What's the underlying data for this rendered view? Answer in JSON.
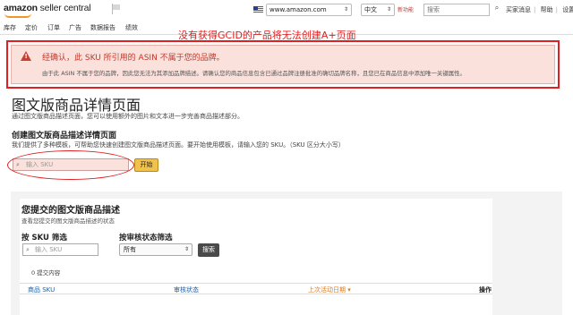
{
  "header": {
    "logo_brand": "amazon",
    "logo_product": "seller central",
    "marketplace": "www.amazon.com",
    "language": "中文",
    "new_badge": "新功能",
    "search_placeholder": "搜索",
    "links": [
      "买家消息",
      "帮助",
      "设置"
    ]
  },
  "nav": [
    "库存",
    "定价",
    "订单",
    "广告",
    "数据报告",
    "绩效"
  ],
  "annotation": "没有获得GCID的产品将无法创建A+页面",
  "error": {
    "title": "经确认，此 SKU 所引用的 ASIN 不属于您的品牌。",
    "description": "由于此 ASIN 不属于您的品牌，因此您无法为其添加品牌描述。请确认您的商品信息包含已通过品牌注册批准的确切品牌名称，且您已在商品信息中添加唯一关键属性。"
  },
  "page": {
    "title": "图文版商品详情页面",
    "subtitle": "通过图文版商品描述页面，您可以使用额外的图片和文本进一步完善商品描述部分。",
    "create_title": "创建图文版商品描述详情页面",
    "create_desc": "我们提供了多种模板，可帮助您快速创建图文版商品描述页面。要开始使用模板，请输入您的 SKU。（SKU 区分大小写）",
    "sku_placeholder": "输入 SKU",
    "start_button": "开始"
  },
  "submitted": {
    "title": "您提交的图文版商品描述",
    "subtitle": "查看您提交的图文版商品描述的状态",
    "filter_sku_label": "按 SKU 筛选",
    "filter_sku_placeholder": "输入 SKU",
    "filter_status_label": "按审核状态筛选",
    "filter_status_value": "所有",
    "search_button": "搜索",
    "count_text": "0 提交内容",
    "columns": [
      "商品 SKU",
      "审核状态",
      "上次活动日期",
      "操作"
    ]
  },
  "colors": {
    "annotation": "#e02020",
    "error_bg": "#fbe1dc",
    "accent_button": "#f0c14b",
    "link": "#1a5fa8",
    "sorted_column": "#e47911"
  }
}
